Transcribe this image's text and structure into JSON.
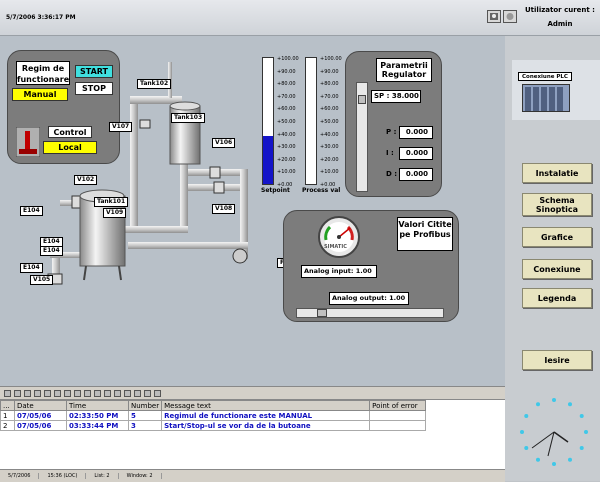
{
  "header": {
    "datetime": "5/7/2006 3:36:17 PM",
    "user_label": "Utilizator curent :",
    "user_name": "Admin"
  },
  "mode_panel": {
    "title": "Regim de functionare",
    "mode_value": "Manual",
    "start": "START",
    "stop": "STOP",
    "control_label": "Control",
    "control_value": "Local"
  },
  "tags": {
    "tank102": "Tank102",
    "tank103": "Tank103",
    "tank101": "Tank101",
    "v107": "V107",
    "v106": "V106",
    "v108": "V108",
    "v102": "V102",
    "v109": "V109",
    "e104a": "E104",
    "e104b": "E104",
    "e104c": "E104",
    "e104d": "E104",
    "e104e": "E104",
    "v105": "V105",
    "p101": "P101"
  },
  "bargraphs": {
    "scale": [
      "+100.00",
      "+90.00",
      "+80.00",
      "+70.00",
      "+60.00",
      "+50.00",
      "+40.00",
      "+30.00",
      "+20.00",
      "+10.00",
      "+0.00"
    ],
    "setpoint_label": "Setpoint",
    "pv_label": "Process val",
    "setpoint_fill_pct": 38,
    "pv_fill_pct": 0
  },
  "regulator": {
    "title": "Parametrii Regulator",
    "sp_label": "SP :",
    "sp_value": "38.000",
    "p_label": "P :",
    "p_value": "0.000",
    "i_label": "I :",
    "i_value": "0.000",
    "d_label": "D :",
    "d_value": "0.000"
  },
  "profibus": {
    "title": "Valori Citite pe Profibus",
    "gauge_brand": "SIMATIC",
    "ai_label": "Analog input:",
    "ai_value": "1.00",
    "ao_label": "Analog output:",
    "ao_value": "1.00"
  },
  "plc": {
    "label": "Conexiune PLC"
  },
  "sidebar": {
    "instalatie": "Instalatie",
    "schema": "Schema Sinoptica",
    "grafice": "Grafice",
    "conexiune": "Conexiune",
    "legenda": "Legenda",
    "iesire": "Iesire"
  },
  "alarms": {
    "columns": [
      "...",
      "Date",
      "Time",
      "Number",
      "Message text",
      "Point of error"
    ],
    "rows": [
      {
        "idx": "1",
        "date": "07/05/06",
        "time": "02:33:50 PM",
        "number": "5",
        "message": "Regimul de functionare este MANUAL",
        "point": ""
      },
      {
        "idx": "2",
        "date": "07/05/06",
        "time": "03:33:44 PM",
        "number": "3",
        "message": "Start/Stop-ul se vor da de la butoane",
        "point": ""
      }
    ]
  },
  "status": {
    "s1": "5/7/2006",
    "s2": "15:36 (LOC)",
    "s3": "List: 2",
    "s4": "Window: 2"
  },
  "colors": {
    "start": "#40e0e0",
    "manual": "#ffff00",
    "local": "#ffff00",
    "bar_fill": "#1414c8",
    "panel": "#7c7c7c"
  }
}
